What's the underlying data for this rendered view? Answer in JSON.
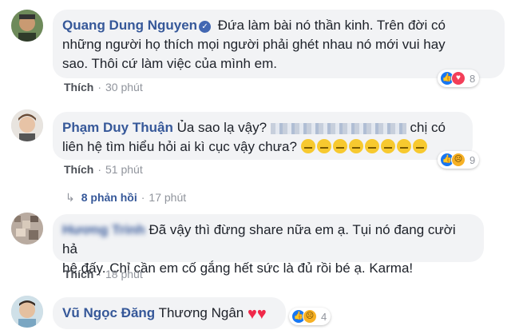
{
  "comments": [
    {
      "author": "Quang Dung Nguyen",
      "text_lines": [
        "Đứa làm bài nó thần kinh. Trên đời có",
        "những người họ thích mọi người phải ghét nhau nó mới vui hay",
        "sao. Thôi cứ làm việc của mình em."
      ],
      "like_label": "Thích",
      "time": "30 phút",
      "reaction_count": "8",
      "reactions": [
        "like-icon",
        "love-icon"
      ]
    },
    {
      "author": "Phạm Duy Thuận",
      "text_line1_pre": "Ủa sao lạ vậy?",
      "text_line1_post": "chị có",
      "text_line2": "liên hệ tìm hiểu hỏi ai kì cục vậy chưa?",
      "like_label": "Thích",
      "time": "51 phút",
      "reaction_count": "9",
      "reactions": [
        "like-icon",
        "sad-icon"
      ],
      "replies_label": "8 phản hồi",
      "replies_time": "17 phút"
    },
    {
      "author": "Hương Trinh",
      "text_lines": [
        "Đã vậy thì đừng share nữa em ạ. Tụi nó đang cười hả",
        "hê đấy. Chỉ cần em cố gắng hết sức là đủ rồi bé ạ. Karma!"
      ],
      "like_label": "Thích",
      "time": "18 phút"
    },
    {
      "author": "Vũ Ngọc Đăng",
      "text": "Thương Ngân",
      "reaction_count": "4",
      "reactions": [
        "like-icon",
        "sad-icon"
      ]
    }
  ],
  "colors": {
    "author": "#365899",
    "bubble": "#f2f3f5",
    "meta": "#90949c"
  }
}
